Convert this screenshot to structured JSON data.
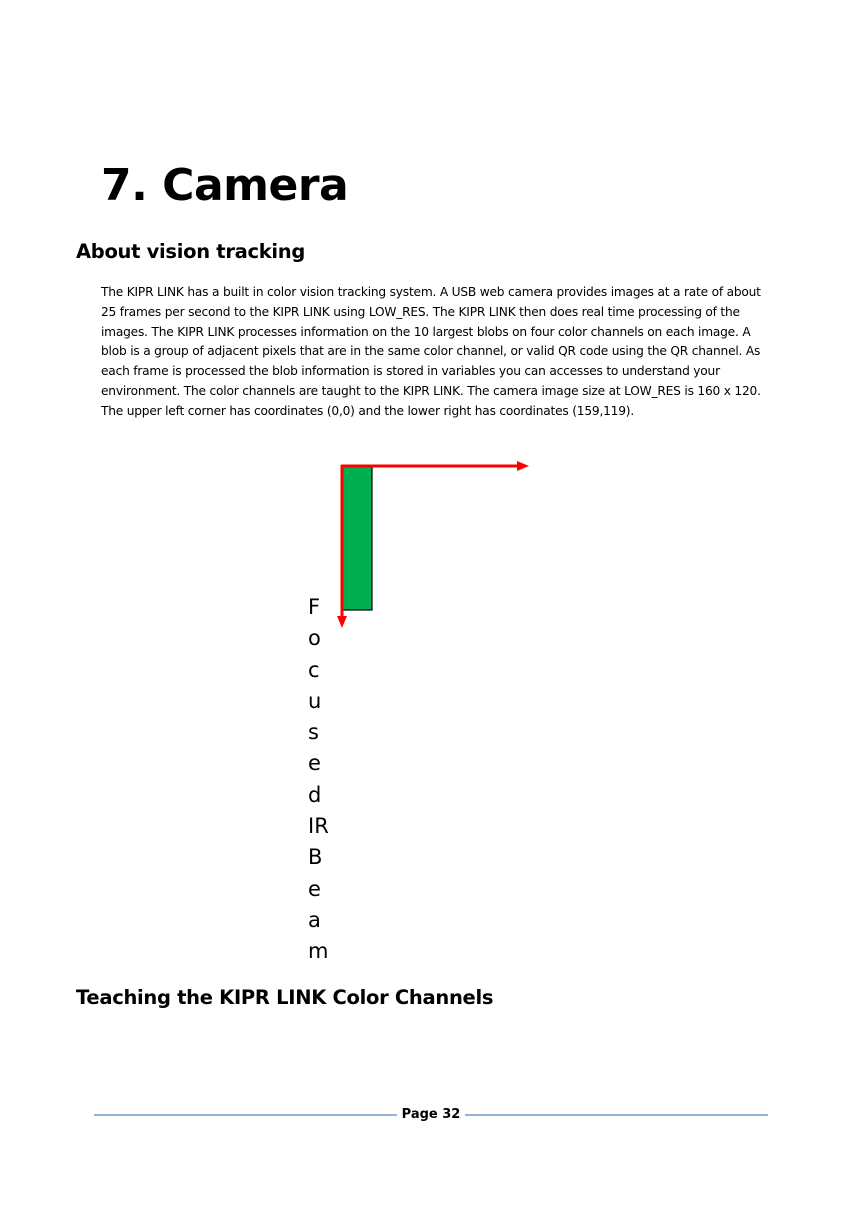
{
  "document": {
    "chapter_title": "7. Camera",
    "sections": [
      {
        "heading": "About vision tracking",
        "paragraph": "The KIPR LINK has a built in color vision tracking system.  A USB web camera provides images at a rate of about 25 frames per second to the KIPR LINK using LOW_RES.  The KIPR LINK then does real time processing of the images.  The KIPR LINK processes information on the 10 largest blobs on four color channels on each image.  A blob is a group of adjacent pixels that are in the same color channel, or valid QR code using the QR channel.  As each frame is processed the blob information is stored in variables you can accesses to understand your environment.  The color channels are taught to the KIPR LINK.  The camera image size at LOW_RES is 160 x 120.  The upper left corner has coordinates (0,0) and the lower right has coordinates (159,119)."
      },
      {
        "heading": "Teaching the KIPR LINK Color Channels"
      }
    ],
    "diagram": {
      "vertical_label_letters": [
        "F",
        "o",
        "c",
        "u",
        "s",
        "e",
        "d",
        "IR",
        "B",
        "e",
        "a",
        "m"
      ],
      "colors": {
        "arrow": "#ff0000",
        "beam_fill": "#00b050",
        "beam_stroke": "#000000"
      }
    },
    "footer": {
      "page_label": "Page 32",
      "line_color": "#95b3d7"
    }
  }
}
